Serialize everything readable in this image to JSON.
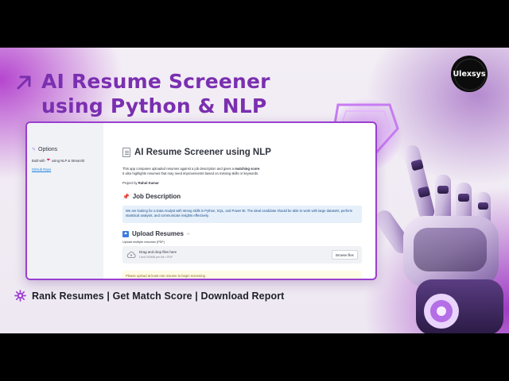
{
  "banner": {
    "headline_line1": "AI Resume Screener",
    "headline_line2": "using Python & NLP",
    "brand": "Ulexsys",
    "tagline": "Rank Resumes | Get Match Score | Download Report",
    "colors": {
      "accent": "#7a2fb0",
      "frame": "#9a3fd0"
    },
    "icons": [
      "arrow-up-right-icon",
      "gear-icon",
      "robot-hand-icon"
    ]
  },
  "app": {
    "sidebar": {
      "title": "Options",
      "built_prefix": "Built with",
      "built_suffix": "using NLP & Streamlit",
      "link": "GitHub Repo"
    },
    "title": "AI Resume Screener using NLP",
    "description_1a": "This app compares uploaded resumes against a job description and gives a ",
    "description_1b": "matching score",
    "description_1c": ".",
    "description_2": "It also highlights resumes that may need improvements based on missing skills or keywords.",
    "byline_prefix": "Project by ",
    "byline_name": "Rahul Kumar",
    "job_section": {
      "heading": "Job Description",
      "text": "We are looking for a Data Analyst with strong skills in Python, SQL, and Power BI. The ideal candidate should be able to work with large datasets, perform statistical analysis, and communicate insights effectively."
    },
    "upload_section": {
      "heading": "Upload Resumes",
      "label": "Upload multiple resumes (PDF)",
      "drop_text": "Drag and drop files here",
      "limit_text": "Limit 200MB per file • PDF",
      "browse_label": "Browse files",
      "warning": "Please upload at least one resume to begin screening."
    }
  }
}
